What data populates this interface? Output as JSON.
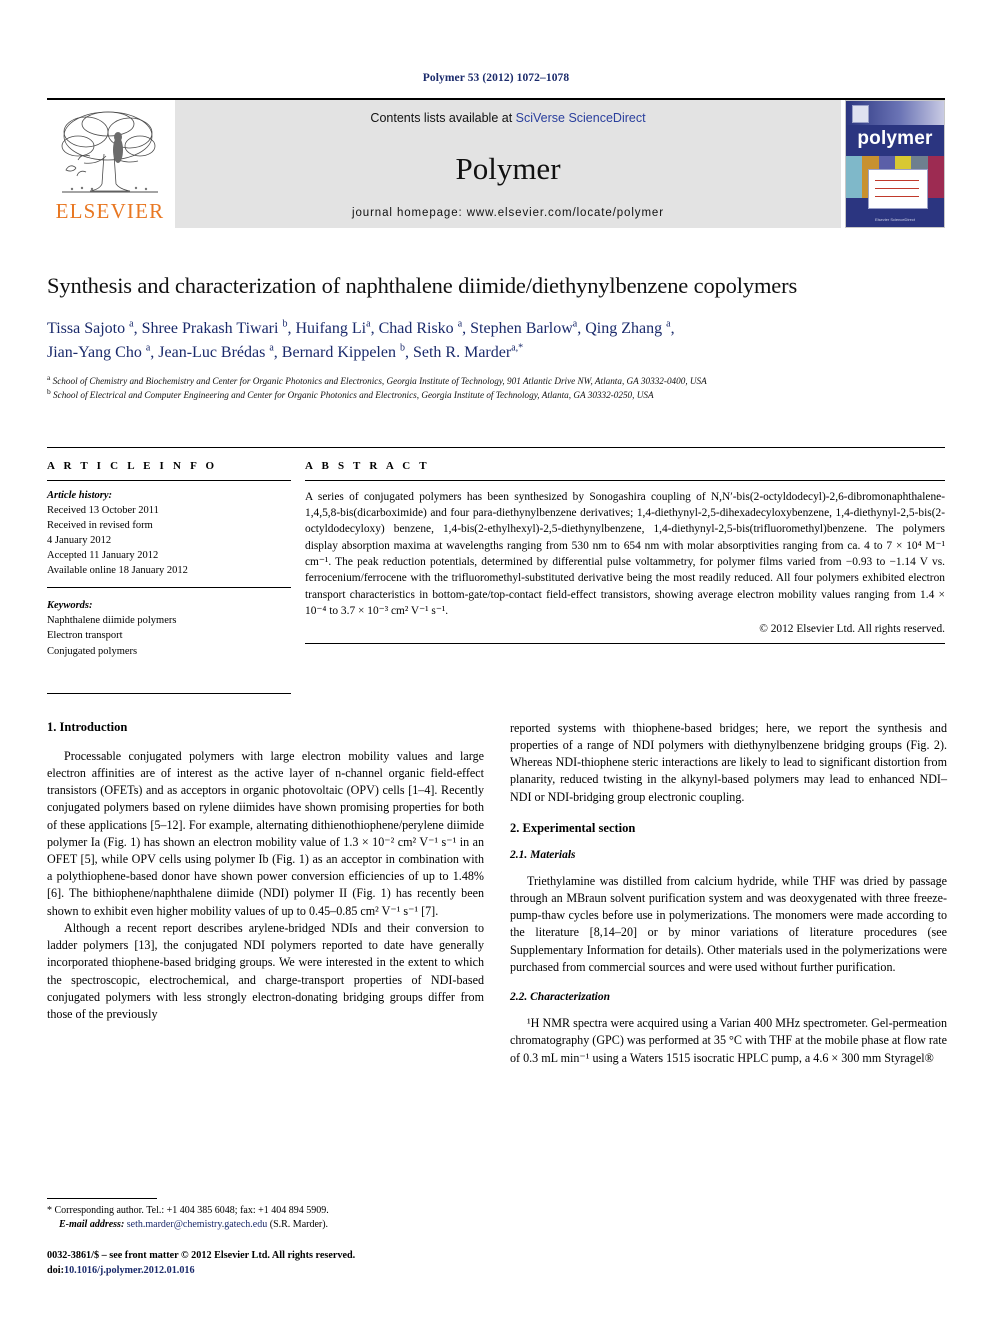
{
  "running_head": "Polymer 53 (2012) 1072–1078",
  "masthead": {
    "contents_prefix": "Contents lists available at ",
    "sciencedirect_link": "SciVerse ScienceDirect",
    "journal_name": "Polymer",
    "homepage": "journal homepage: www.elsevier.com/locate/polymer",
    "publisher_wordmark": "ELSEVIER",
    "cover_title": "polymer",
    "cover_footer": "Elsevier ScienceDirect",
    "accent_orange": "#E87722",
    "link_blue": "#2a3f9d",
    "cover_blue": "#2b3580"
  },
  "article": {
    "title": "Synthesis and characterization of naphthalene diimide/diethynylbenzene copolymers",
    "authors_line1": "Tissa Sajoto a, Shree Prakash Tiwari b, Huifang Li a, Chad Risko a, Stephen Barlow a, Qing Zhang a,",
    "authors_line2": "Jian-Yang Cho a, Jean-Luc Brédas a, Bernard Kippelen b, Seth R. Marder a,*",
    "affiliation_a": "School of Chemistry and Biochemistry and Center for Organic Photonics and Electronics, Georgia Institute of Technology, 901 Atlantic Drive NW, Atlanta, GA 30332-0400, USA",
    "affiliation_b": "School of Electrical and Computer Engineering and Center for Organic Photonics and Electronics, Georgia Institute of Technology, Atlanta, GA 30332-0250, USA"
  },
  "article_info": {
    "heading": "A R T I C L E  I N F O",
    "history_label": "Article history:",
    "history": [
      "Received 13 October 2011",
      "Received in revised form",
      "4 January 2012",
      "Accepted 11 January 2012",
      "Available online 18 January 2012"
    ],
    "keywords_label": "Keywords:",
    "keywords": [
      "Naphthalene diimide polymers",
      "Electron transport",
      "Conjugated polymers"
    ]
  },
  "abstract": {
    "heading": "A B S T R A C T",
    "text": "A series of conjugated polymers has been synthesized by Sonogashira coupling of N,N′-bis(2-octyldodecyl)-2,6-dibromonaphthalene-1,4,5,8-bis(dicarboximide) and four para-diethynylbenzene derivatives; 1,4-diethynyl-2,5-dihexadecyloxybenzene, 1,4-diethynyl-2,5-bis(2-octyldodecyloxy) benzene, 1,4-bis(2-ethylhexyl)-2,5-diethynylbenzene, 1,4-diethynyl-2,5-bis(trifluoromethyl)benzene. The polymers display absorption maxima at wavelengths ranging from 530 nm to 654 nm with molar absorptivities ranging from ca. 4 to 7 × 10⁴ M⁻¹ cm⁻¹. The peak reduction potentials, determined by differential pulse voltammetry, for polymer films varied from −0.93 to −1.14 V vs. ferrocenium/ferrocene with the trifluoromethyl-substituted derivative being the most readily reduced. All four polymers exhibited electron transport characteristics in bottom-gate/top-contact field-effect transistors, showing average electron mobility values ranging from 1.4 × 10⁻⁴ to 3.7 × 10⁻³ cm² V⁻¹ s⁻¹.",
    "copyright": "© 2012 Elsevier Ltd. All rights reserved."
  },
  "sections": {
    "introduction_heading": "1. Introduction",
    "intro_p1": "Processable conjugated polymers with large electron mobility values and large electron affinities are of interest as the active layer of n-channel organic field-effect transistors (OFETs) and as acceptors in organic photovoltaic (OPV) cells [1–4]. Recently conjugated polymers based on rylene diimides have shown promising properties for both of these applications [5–12]. For example, alternating dithienothiophene/perylene diimide polymer Ia (Fig. 1) has shown an electron mobility value of 1.3 × 10⁻² cm² V⁻¹ s⁻¹ in an OFET [5], while OPV cells using polymer Ib (Fig. 1) as an acceptor in combination with a polythiophene-based donor have shown power conversion efficiencies of up to 1.48% [6]. The bithiophene/naphthalene diimide (NDI) polymer II (Fig. 1) has recently been shown to exhibit even higher mobility values of up to 0.45–0.85 cm² V⁻¹ s⁻¹ [7].",
    "intro_p2": "Although a recent report describes arylene-bridged NDIs and their conversion to ladder polymers [13], the conjugated NDI polymers reported to date have generally incorporated thiophene-based bridging groups. We were interested in the extent to which the spectroscopic, electrochemical, and charge-transport properties of NDI-based conjugated polymers with less strongly electron-donating bridging groups differ from those of the previously",
    "intro_p2_cont": "reported systems with thiophene-based bridges; here, we report the synthesis and properties of a range of NDI polymers with diethynylbenzene bridging groups (Fig. 2). Whereas NDI-thiophene steric interactions are likely to lead to significant distortion from planarity, reduced twisting in the alkynyl-based polymers may lead to enhanced NDI–NDI or NDI-bridging group electronic coupling.",
    "experimental_heading": "2. Experimental section",
    "materials_heading": "2.1. Materials",
    "materials_p1": "Triethylamine was distilled from calcium hydride, while THF was dried by passage through an MBraun solvent purification system and was deoxygenated with three freeze-pump-thaw cycles before use in polymerizations. The monomers were made according to the literature [8,14–20] or by minor variations of literature procedures (see Supplementary Information for details). Other materials used in the polymerizations were purchased from commercial sources and were used without further purification.",
    "characterization_heading": "2.2. Characterization",
    "characterization_p1": "¹H NMR spectra were acquired using a Varian 400 MHz spectrometer. Gel-permeation chromatography (GPC) was performed at 35 °C with THF at the mobile phase at flow rate of 0.3 mL min⁻¹ using a Waters 1515 isocratic HPLC pump, a 4.6 × 300 mm Styragel®"
  },
  "footer": {
    "corresponding": "* Corresponding author. Tel.: +1 404 385 6048; fax: +1 404 894 5909.",
    "email_label": "E-mail address:",
    "email": "seth.marder@chemistry.gatech.edu",
    "email_suffix": "(S.R. Marder).",
    "issn_line": "0032-3861/$ – see front matter © 2012 Elsevier Ltd. All rights reserved.",
    "doi_label": "doi:",
    "doi": "10.1016/j.polymer.2012.01.016"
  }
}
